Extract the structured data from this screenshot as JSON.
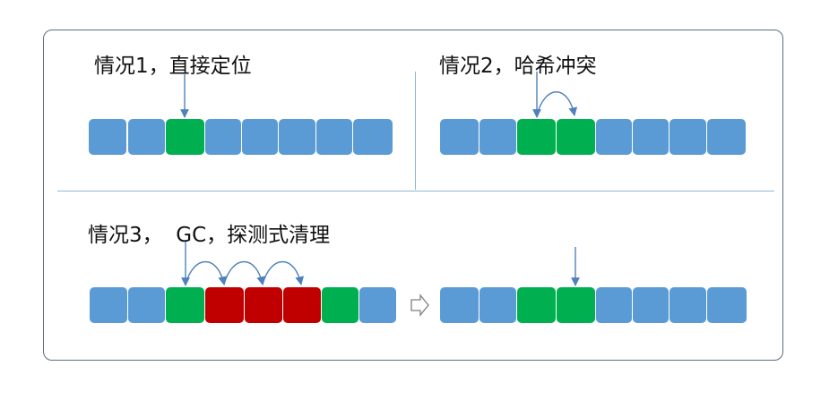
{
  "panels": {
    "case1_title": "情况1，直接定位",
    "case2_title": "情况2，哈希冲突",
    "case3_title": "情况3，  GC，探测式清理"
  },
  "colors": {
    "empty_slot": "#5b9bd5",
    "occupied_slot": "#00b050",
    "stale_slot": "#c00000",
    "arrow": "#4f81bd",
    "frame": "#5a6f7f",
    "divider": "#8fb6d3"
  },
  "transition_icon": "hollow-right-arrow-icon"
}
